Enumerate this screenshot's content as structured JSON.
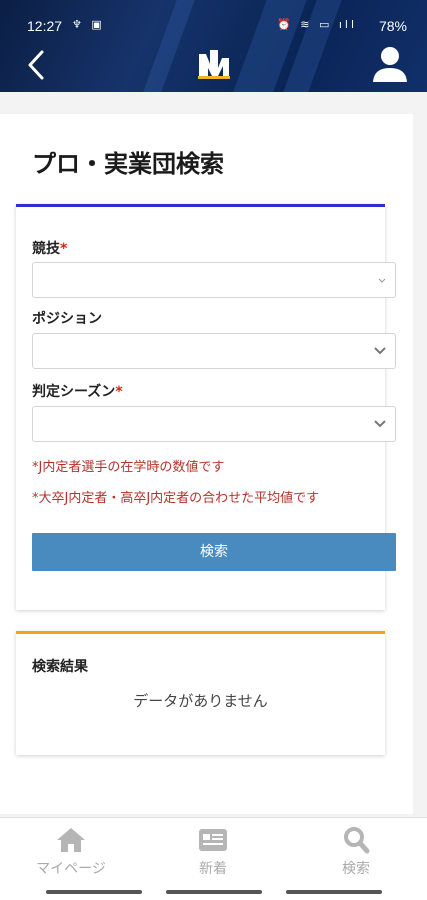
{
  "status_bar": {
    "time": "12:27",
    "left_icons": "♆ ▣",
    "right_icons": "⏰ ≋ ▭ ıll",
    "battery": "78%"
  },
  "header": {
    "back_icon": "chevron-left-icon",
    "logo_icon": "brand-logo-icon",
    "user_icon": "user-icon",
    "brand_color": "#1a3a78"
  },
  "page": {
    "title": "プロ・実業団検索"
  },
  "form": {
    "accent_color": "#2c2fd8",
    "fields": [
      {
        "label": "競技",
        "required_mark": "*",
        "value": ""
      },
      {
        "label": "ポジション",
        "required_mark": "",
        "value": ""
      },
      {
        "label": "判定シーズン",
        "required_mark": "*",
        "value": ""
      }
    ],
    "notes": [
      "*J内定者選手の在学時の数値です",
      "*大卒J内定者・高卒J内定者の合わせた平均値です"
    ],
    "search_button": "検索",
    "button_color": "#4a8bbf"
  },
  "results": {
    "accent_color": "#f0a21a",
    "title": "検索結果",
    "empty_message": "データがありません"
  },
  "bottom_nav": {
    "items": [
      {
        "label": "マイページ",
        "icon": "home-icon"
      },
      {
        "label": "新着",
        "icon": "news-icon"
      },
      {
        "label": "検索",
        "icon": "search-icon"
      }
    ]
  }
}
